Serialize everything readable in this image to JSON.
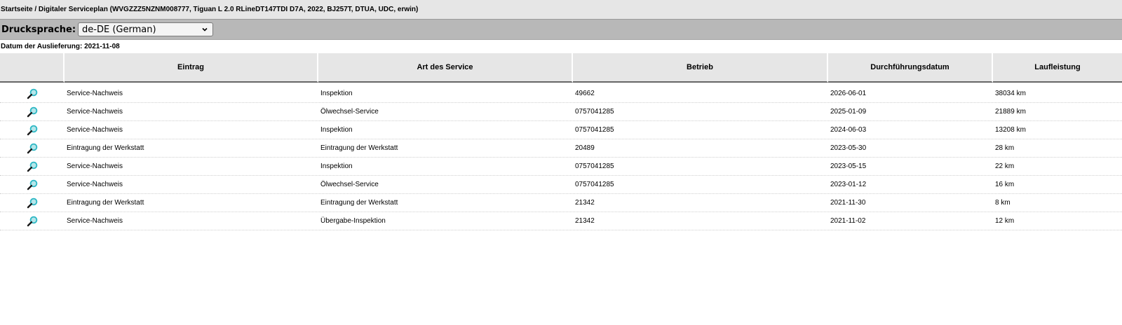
{
  "breadcrumb": "Startseite / Digitaler Serviceplan (WVGZZZ5NZNM008777, Tiguan L 2.0 RLineDT147TDI D7A, 2022, BJ257T, DTUA, UDC, erwin)",
  "print_language": {
    "label": "Drucksprache:",
    "selected": "de-DE (German)"
  },
  "delivery_date": "Datum der Auslieferung: 2021-11-08",
  "table": {
    "headers": [
      "",
      "Eintrag",
      "Art des Service",
      "Betrieb",
      "Durchführungsdatum",
      "Laufleistung"
    ],
    "rows": [
      [
        "Service-Nachweis",
        "Inspektion",
        "49662",
        "2026-06-01",
        "38034 km"
      ],
      [
        "Service-Nachweis",
        "Ölwechsel-Service",
        "0757041285",
        "2025-01-09",
        "21889 km"
      ],
      [
        "Service-Nachweis",
        "Inspektion",
        "0757041285",
        "2024-06-03",
        "13208 km"
      ],
      [
        "Eintragung der Werkstatt",
        "Eintragung der Werkstatt",
        "20489",
        "2023-05-30",
        "28 km"
      ],
      [
        "Service-Nachweis",
        "Inspektion",
        "0757041285",
        "2023-05-15",
        "22 km"
      ],
      [
        "Service-Nachweis",
        "Ölwechsel-Service",
        "0757041285",
        "2023-01-12",
        "16 km"
      ],
      [
        "Eintragung der Werkstatt",
        "Eintragung der Werkstatt",
        "21342",
        "2021-11-30",
        "8 km"
      ],
      [
        "Service-Nachweis",
        "Übergabe-Inspektion",
        "21342",
        "2021-11-02",
        "12 km"
      ]
    ]
  },
  "icons": {
    "row_action": "magnifier-icon",
    "select": "chevron-down-icon"
  },
  "colors": {
    "magnifier_lens": "#2bb7c4",
    "header_bg": "#e6e6e6",
    "toolbar_bg": "#b8b8b8"
  }
}
